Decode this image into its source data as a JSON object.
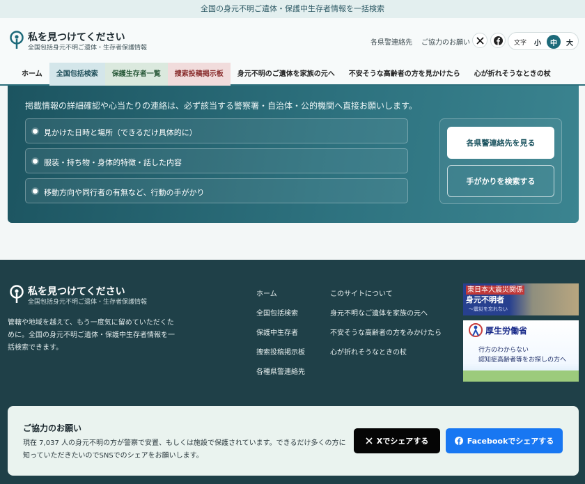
{
  "topbar": {
    "text": "全国の身元不明ご遺体・保護中生存者情報を一括検索"
  },
  "header": {
    "title": "私を見つけてください",
    "subtitle": "全国包括身元不明ご遺体・生存者保護情報",
    "links": [
      "各県警連絡先",
      "ご協力のお願い"
    ],
    "social_icons": [
      "x-icon",
      "facebook-icon"
    ],
    "font_size": {
      "label": "文字",
      "options": [
        "小",
        "中",
        "大"
      ],
      "selected": "中"
    }
  },
  "nav": {
    "items": [
      "ホーム",
      "全国包括検索",
      "保護生存者一覧",
      "捜索投稿掲示板",
      "身元不明のご遺体を家族の元へ",
      "不安そうな高齢者の方を見かけたら",
      "心が折れそうなときの杖"
    ]
  },
  "panel": {
    "lead": "掲載情報の詳細確認や心当たりの連絡は、必ず該当する警察署・自治体・公的機関へ直接お願いします。",
    "checklist": [
      "見かけた日時と場所（できるだけ具体的に）",
      "服装・持ち物・身体的特徴・話した内容",
      "移動方向や同行者の有無など、行動の手がかり"
    ],
    "primary_button": "各県警連絡先を見る",
    "secondary_button": "手がかりを検索する"
  },
  "footer": {
    "title": "私を見つけてください",
    "subtitle": "全国包括身元不明ご遺体・生存者保護情報",
    "description": "管轄や地域を越えて、もう一度気に留めていただくために。全国の身元不明ご遺体・保護中生存者情報を一括検索できます。",
    "links_col1": [
      "ホーム",
      "全国包括検索",
      "保護中生存者",
      "捜索投稿掲示板",
      "各種県警連絡先"
    ],
    "links_col2": [
      "このサイトについて",
      "身元不明なご遺体を家族の元へ",
      "不安そうな高齢者の方をみかけたら",
      "心が折れそうなときの杖"
    ],
    "banner1": {
      "tag": "東日本大震災関係",
      "title": "身元不明者",
      "sub": "〜震災を忘れない"
    },
    "banner2": {
      "title": "厚生労働省",
      "line1": "行方のわからない",
      "line2": "認知症高齢者等をお探しの方へ"
    }
  },
  "cooperation": {
    "title": "ご協力のお願い",
    "text": "現在 7,037 人の身元不明の方が警察で安置、もしくは施設で保護されています。できるだけ多くの方に知っていただきたいのでSNSでのシェアをお願いします。",
    "share_x": "Xでシェアする",
    "share_facebook": "Facebookでシェアする"
  }
}
